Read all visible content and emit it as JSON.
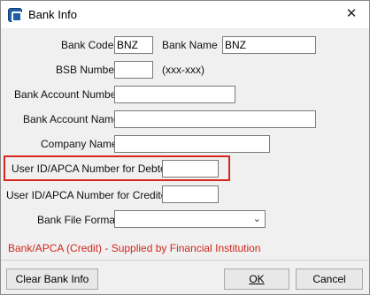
{
  "window": {
    "title": "Bank Info",
    "close_label": "✕"
  },
  "fields": {
    "bank_code": {
      "label": "Bank Code",
      "value": "BNZ"
    },
    "bank_name": {
      "label": "Bank Name",
      "value": "BNZ"
    },
    "bsb_number": {
      "label": "BSB Number",
      "value": "",
      "hint": "(xxx-xxx)"
    },
    "bank_account_number": {
      "label": "Bank Account Number",
      "value": ""
    },
    "bank_account_name": {
      "label": "Bank Account Name",
      "value": ""
    },
    "company_name": {
      "label": "Company Name",
      "value": ""
    },
    "user_id_debtors": {
      "label": "User ID/APCA Number for Debtors",
      "value": ""
    },
    "user_id_creditors": {
      "label": "User ID/APCA Number for Creditors",
      "value": ""
    },
    "bank_file_format": {
      "label": "Bank File Format",
      "selected": ""
    }
  },
  "note": "Bank/APCA (Credit) - Supplied by Financial Institution",
  "buttons": {
    "clear": "Clear Bank Info",
    "ok": "OK",
    "cancel": "Cancel"
  },
  "colors": {
    "highlight": "#d9261c",
    "note": "#d0261c",
    "accent": "#1f5fa8"
  }
}
